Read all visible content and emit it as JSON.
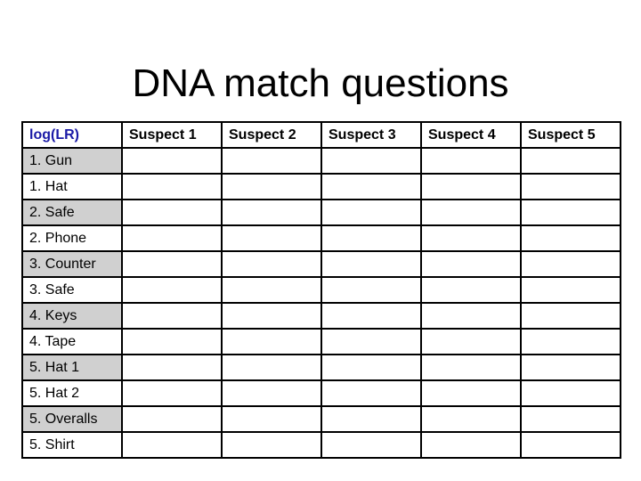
{
  "title": "DNA match questions",
  "table": {
    "corner_header": "log(LR)",
    "columns": [
      "Suspect 1",
      "Suspect 2",
      "Suspect 3",
      "Suspect 4",
      "Suspect 5"
    ],
    "rows": [
      {
        "label": "1. Gun",
        "shaded": true,
        "values": [
          "",
          "",
          "",
          "",
          ""
        ]
      },
      {
        "label": "1. Hat",
        "shaded": false,
        "values": [
          "",
          "",
          "",
          "",
          ""
        ]
      },
      {
        "label": "2. Safe",
        "shaded": true,
        "values": [
          "",
          "",
          "",
          "",
          ""
        ]
      },
      {
        "label": "2. Phone",
        "shaded": false,
        "values": [
          "",
          "",
          "",
          "",
          ""
        ]
      },
      {
        "label": "3. Counter",
        "shaded": true,
        "values": [
          "",
          "",
          "",
          "",
          ""
        ]
      },
      {
        "label": "3. Safe",
        "shaded": false,
        "values": [
          "",
          "",
          "",
          "",
          ""
        ]
      },
      {
        "label": "4. Keys",
        "shaded": true,
        "values": [
          "",
          "",
          "",
          "",
          ""
        ]
      },
      {
        "label": "4. Tape",
        "shaded": false,
        "values": [
          "",
          "",
          "",
          "",
          ""
        ]
      },
      {
        "label": "5. Hat 1",
        "shaded": true,
        "values": [
          "",
          "",
          "",
          "",
          ""
        ]
      },
      {
        "label": "5. Hat 2",
        "shaded": false,
        "values": [
          "",
          "",
          "",
          "",
          ""
        ]
      },
      {
        "label": "5. Overalls",
        "shaded": true,
        "values": [
          "",
          "",
          "",
          "",
          ""
        ]
      },
      {
        "label": "5. Shirt",
        "shaded": false,
        "values": [
          "",
          "",
          "",
          "",
          ""
        ]
      }
    ]
  },
  "colors": {
    "corner_header_text": "#1a1aa6",
    "shaded_row": "#d0d0d0"
  }
}
